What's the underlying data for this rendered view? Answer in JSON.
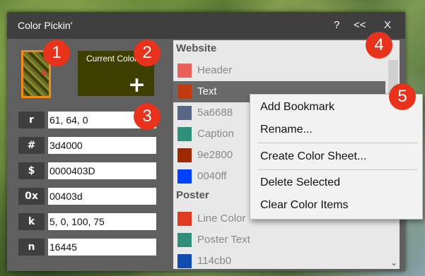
{
  "window": {
    "title": "Color Pickin'",
    "help": "?",
    "collapse": "<<",
    "close": "X"
  },
  "current": {
    "label": "Current Color",
    "add": "+"
  },
  "fields": [
    {
      "key": "r",
      "value": "61, 64, 0"
    },
    {
      "key": "#",
      "value": "3d4000"
    },
    {
      "key": "$",
      "value": "0000403D"
    },
    {
      "key": "0x",
      "value": "00403d"
    },
    {
      "key": "k",
      "value": "5, 0, 100, 75"
    },
    {
      "key": "n",
      "value": "16445"
    }
  ],
  "groups": [
    {
      "name": "Website",
      "items": [
        {
          "label": "Header",
          "color": "#e8615a"
        },
        {
          "label": "Text",
          "color": "#c23a12",
          "selected": true
        },
        {
          "label": "5a6688",
          "color": "#5a6688"
        },
        {
          "label": "Caption",
          "color": "#2f8f7a"
        },
        {
          "label": "9e2800",
          "color": "#9e2800"
        },
        {
          "label": "0040ff",
          "color": "#0040ff"
        }
      ]
    },
    {
      "name": "Poster",
      "items": [
        {
          "label": "Line Color",
          "color": "#e03a22"
        },
        {
          "label": "Poster Text",
          "color": "#2f8f7a"
        },
        {
          "label": "114cb0",
          "color": "#114cb0"
        }
      ]
    }
  ],
  "menu": [
    "Add Bookmark",
    "Rename...",
    "Create Color Sheet...",
    "Delete Selected",
    "Clear Color Items"
  ],
  "badges": [
    "1",
    "2",
    "3",
    "4",
    "5"
  ],
  "colors": {
    "accent": "#f08a1a",
    "badge": "#e8321c",
    "current": "#3d4000",
    "titlebar": "#3f3f3f"
  }
}
